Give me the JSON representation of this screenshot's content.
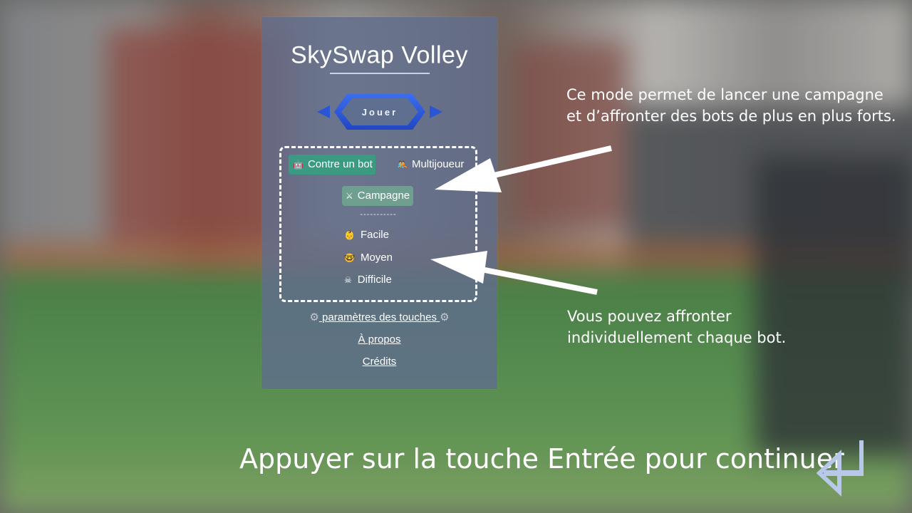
{
  "game": {
    "title": "SkySwap Volley",
    "play_label": "Jouer"
  },
  "mode_tabs": [
    {
      "label": "Contre un bot",
      "icon": "robot-icon",
      "active": true
    },
    {
      "label": "Multijoueur",
      "icon": "people-icon",
      "active": false
    }
  ],
  "campaign": {
    "label": "Campagne",
    "icon": "crossed-swords-icon"
  },
  "separator": "-----------",
  "difficulties": [
    {
      "label": "Facile",
      "icon": "baby-icon"
    },
    {
      "label": "Moyen",
      "icon": "nerd-face-icon"
    },
    {
      "label": "Difficile",
      "icon": "skull-crossbones-icon"
    }
  ],
  "links": {
    "settings": "paramètres des touches",
    "about": "À propos",
    "credits": "Crédits"
  },
  "annotations": {
    "campaign_note_line1": "Ce mode permet de lancer une campagne",
    "campaign_note_line2": "et d’affronter des bots de plus en plus forts.",
    "bots_note_line1": "Vous pouvez affronter",
    "bots_note_line2": "individuellement chaque bot."
  },
  "footer": {
    "prompt": "Appuyer sur la touche Entrée pour continuer",
    "icon": "enter-key-icon"
  },
  "colors": {
    "panel": "#606e8c",
    "play_button": "#2a55d6",
    "active_tab": "#3a9a82",
    "campaign_button": "#6fa08f",
    "enter_icon": "#b8c8e8"
  }
}
